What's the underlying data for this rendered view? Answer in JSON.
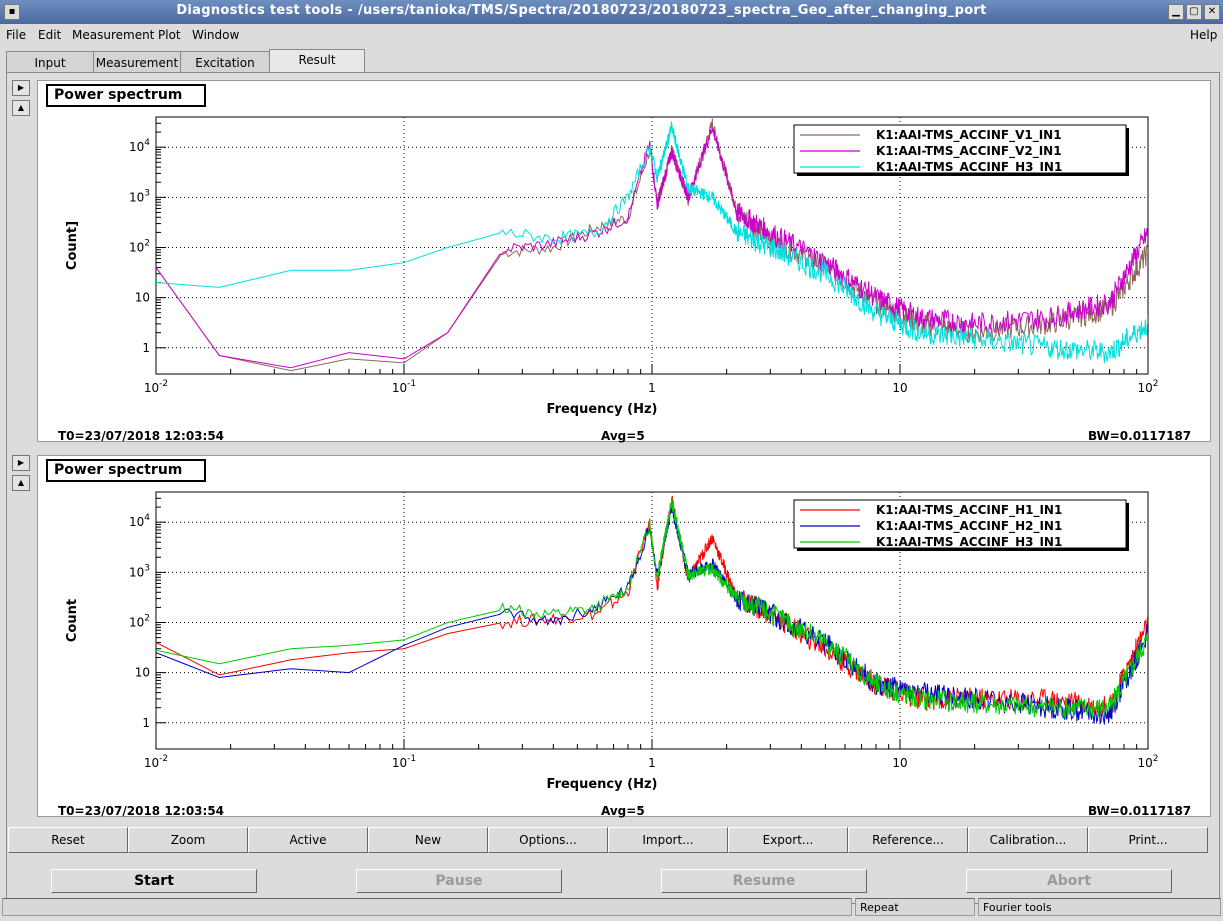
{
  "window": {
    "title": "Diagnostics test tools - /users/tanioka/TMS/Spectra/20180723/20180723_spectra_Geo_after_changing_port"
  },
  "menu": {
    "items": [
      {
        "label": "File"
      },
      {
        "label": "Edit"
      },
      {
        "label": "Measurement"
      },
      {
        "label": "Plot"
      },
      {
        "label": "Window"
      }
    ],
    "help": "Help"
  },
  "tabs": [
    {
      "label": "Input"
    },
    {
      "label": "Measurement"
    },
    {
      "label": "Excitation"
    },
    {
      "label": "Result",
      "active": true
    }
  ],
  "panels": [
    {
      "title": "Power spectrum",
      "ylabel": "Count]",
      "xlabel": "Frequency (Hz)",
      "t0": "T0=23/07/2018 12:03:54",
      "avg": "Avg=5",
      "bw": "BW=0.0117187",
      "legend": [
        {
          "name": "K1:AAI-TMS_ACCINF_V1_IN1",
          "color": "#8b6a5a"
        },
        {
          "name": "K1:AAI-TMS_ACCINF_V2_IN1",
          "color": "#cc00cc"
        },
        {
          "name": "K1:AAI-TMS_ACCINF_H3_IN1",
          "color": "#00e0e0"
        }
      ]
    },
    {
      "title": "Power spectrum",
      "ylabel": "Count",
      "xlabel": "Frequency (Hz)",
      "t0": "T0=23/07/2018 12:03:54",
      "avg": "Avg=5",
      "bw": "BW=0.0117187",
      "legend": [
        {
          "name": "K1:AAI-TMS_ACCINF_H1_IN1",
          "color": "#ff0000"
        },
        {
          "name": "K1:AAI-TMS_ACCINF_H2_IN1",
          "color": "#0000cc"
        },
        {
          "name": "K1:AAI-TMS_ACCINF_H3_IN1",
          "color": "#00cc00"
        }
      ]
    }
  ],
  "chart_data": [
    {
      "type": "line",
      "title": "Power spectrum",
      "xlabel": "Frequency (Hz)",
      "ylabel": "Count]",
      "xscale": "log",
      "yscale": "log",
      "xlim": [
        0.01,
        100
      ],
      "ylim": [
        0.3,
        40000
      ],
      "xticks": [
        "10^-2",
        "10^-1",
        "1",
        "10",
        "10^2"
      ],
      "yticks": [
        "1",
        "10",
        "10^2",
        "10^3",
        "10^4"
      ],
      "grid": true,
      "legend_position": "top-right",
      "series": [
        {
          "name": "K1:AAI-TMS_ACCINF_V1_IN1",
          "color": "#8b6a5a",
          "x": [
            0.01,
            0.018,
            0.035,
            0.06,
            0.1,
            0.15,
            0.25,
            0.4,
            0.6,
            0.8,
            0.98,
            1.05,
            1.2,
            1.4,
            1.75,
            2.2,
            3,
            5,
            8,
            12,
            20,
            40,
            70,
            100
          ],
          "y": [
            40,
            0.7,
            0.35,
            0.6,
            0.5,
            2,
            80,
            100,
            250,
            400,
            9000,
            800,
            9000,
            900,
            30000,
            500,
            150,
            40,
            8,
            3,
            2,
            3,
            6,
            80
          ]
        },
        {
          "name": "K1:AAI-TMS_ACCINF_V2_IN1",
          "color": "#cc00cc",
          "x": [
            0.01,
            0.018,
            0.035,
            0.06,
            0.1,
            0.15,
            0.25,
            0.4,
            0.6,
            0.8,
            0.98,
            1.05,
            1.2,
            1.4,
            1.75,
            2.2,
            3,
            5,
            8,
            12,
            20,
            40,
            70,
            100
          ],
          "y": [
            40,
            0.7,
            0.4,
            0.8,
            0.6,
            2,
            90,
            120,
            200,
            400,
            12000,
            700,
            8000,
            1000,
            25000,
            500,
            200,
            50,
            10,
            4,
            3,
            4,
            8,
            200
          ]
        },
        {
          "name": "K1:AAI-TMS_ACCINF_H3_IN1",
          "color": "#00e0e0",
          "x": [
            0.01,
            0.018,
            0.035,
            0.06,
            0.1,
            0.15,
            0.25,
            0.4,
            0.6,
            0.8,
            0.98,
            1.05,
            1.2,
            1.4,
            1.75,
            2.2,
            3,
            5,
            8,
            12,
            20,
            40,
            70,
            100
          ],
          "y": [
            20,
            16,
            35,
            35,
            50,
            100,
            200,
            150,
            200,
            1000,
            10000,
            2500,
            25000,
            1500,
            1000,
            200,
            100,
            30,
            5,
            2,
            1.5,
            1,
            0.8,
            3
          ]
        }
      ]
    },
    {
      "type": "line",
      "title": "Power spectrum",
      "xlabel": "Frequency (Hz)",
      "ylabel": "Count",
      "xscale": "log",
      "yscale": "log",
      "xlim": [
        0.01,
        100
      ],
      "ylim": [
        0.3,
        40000
      ],
      "xticks": [
        "10^-2",
        "10^-1",
        "1",
        "10",
        "10^2"
      ],
      "yticks": [
        "1",
        "10",
        "10^2",
        "10^3",
        "10^4"
      ],
      "grid": true,
      "legend_position": "top-right",
      "series": [
        {
          "name": "K1:AAI-TMS_ACCINF_H1_IN1",
          "color": "#ff0000",
          "x": [
            0.01,
            0.018,
            0.035,
            0.06,
            0.1,
            0.15,
            0.25,
            0.4,
            0.6,
            0.8,
            0.98,
            1.05,
            1.2,
            1.4,
            1.75,
            2.2,
            3,
            5,
            8,
            12,
            20,
            40,
            70,
            100
          ],
          "y": [
            40,
            9,
            18,
            25,
            30,
            60,
            100,
            120,
            150,
            400,
            10000,
            500,
            30000,
            700,
            5000,
            300,
            150,
            30,
            6,
            3,
            3,
            3,
            2,
            100
          ]
        },
        {
          "name": "K1:AAI-TMS_ACCINF_H2_IN1",
          "color": "#0000cc",
          "x": [
            0.01,
            0.018,
            0.035,
            0.06,
            0.1,
            0.15,
            0.25,
            0.4,
            0.6,
            0.8,
            0.98,
            1.05,
            1.2,
            1.4,
            1.75,
            2.2,
            3,
            5,
            8,
            12,
            20,
            40,
            70,
            100
          ],
          "y": [
            25,
            8,
            12,
            10,
            35,
            80,
            150,
            100,
            200,
            500,
            8000,
            800,
            20000,
            900,
            1500,
            300,
            150,
            40,
            6,
            4,
            3,
            2,
            1.5,
            60
          ]
        },
        {
          "name": "K1:AAI-TMS_ACCINF_H3_IN1",
          "color": "#00cc00",
          "x": [
            0.01,
            0.018,
            0.035,
            0.06,
            0.1,
            0.15,
            0.25,
            0.4,
            0.6,
            0.8,
            0.98,
            1.05,
            1.2,
            1.4,
            1.75,
            2.2,
            3,
            5,
            8,
            12,
            20,
            40,
            70,
            100
          ],
          "y": [
            28,
            15,
            30,
            35,
            45,
            100,
            180,
            150,
            200,
            500,
            9000,
            800,
            25000,
            900,
            1200,
            300,
            150,
            40,
            6,
            3,
            2.5,
            2,
            2,
            50
          ]
        }
      ]
    }
  ],
  "buttons": [
    "Reset",
    "Zoom",
    "Active",
    "New",
    "Options...",
    "Import...",
    "Export...",
    "Reference...",
    "Calibration...",
    "Print..."
  ],
  "controls": [
    {
      "label": "Start",
      "enabled": true
    },
    {
      "label": "Pause",
      "enabled": false
    },
    {
      "label": "Resume",
      "enabled": false
    },
    {
      "label": "Abort",
      "enabled": false
    }
  ],
  "status": {
    "left": "",
    "repeat": "Repeat",
    "mode": "Fourier tools"
  }
}
